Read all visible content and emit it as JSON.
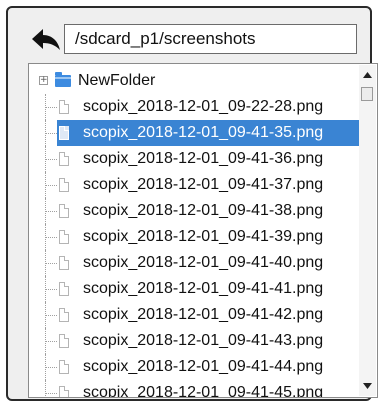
{
  "toolbar": {
    "back_icon": "back-arrow-icon",
    "path": "/sdcard_p1/screenshots"
  },
  "tree": {
    "folder": {
      "label": "NewFolder",
      "icon": "folder-icon",
      "expander": "+"
    },
    "files": [
      "scopix_2018-12-01_09-22-28.png",
      "scopix_2018-12-01_09-41-35.png",
      "scopix_2018-12-01_09-41-36.png",
      "scopix_2018-12-01_09-41-37.png",
      "scopix_2018-12-01_09-41-38.png",
      "scopix_2018-12-01_09-41-39.png",
      "scopix_2018-12-01_09-41-40.png",
      "scopix_2018-12-01_09-41-41.png",
      "scopix_2018-12-01_09-41-42.png",
      "scopix_2018-12-01_09-41-43.png",
      "scopix_2018-12-01_09-41-44.png",
      "scopix_2018-12-01_09-41-45.png"
    ],
    "selected_index": 1
  },
  "colors": {
    "selection": "#3a84d3",
    "folder": "#3d8be0"
  }
}
